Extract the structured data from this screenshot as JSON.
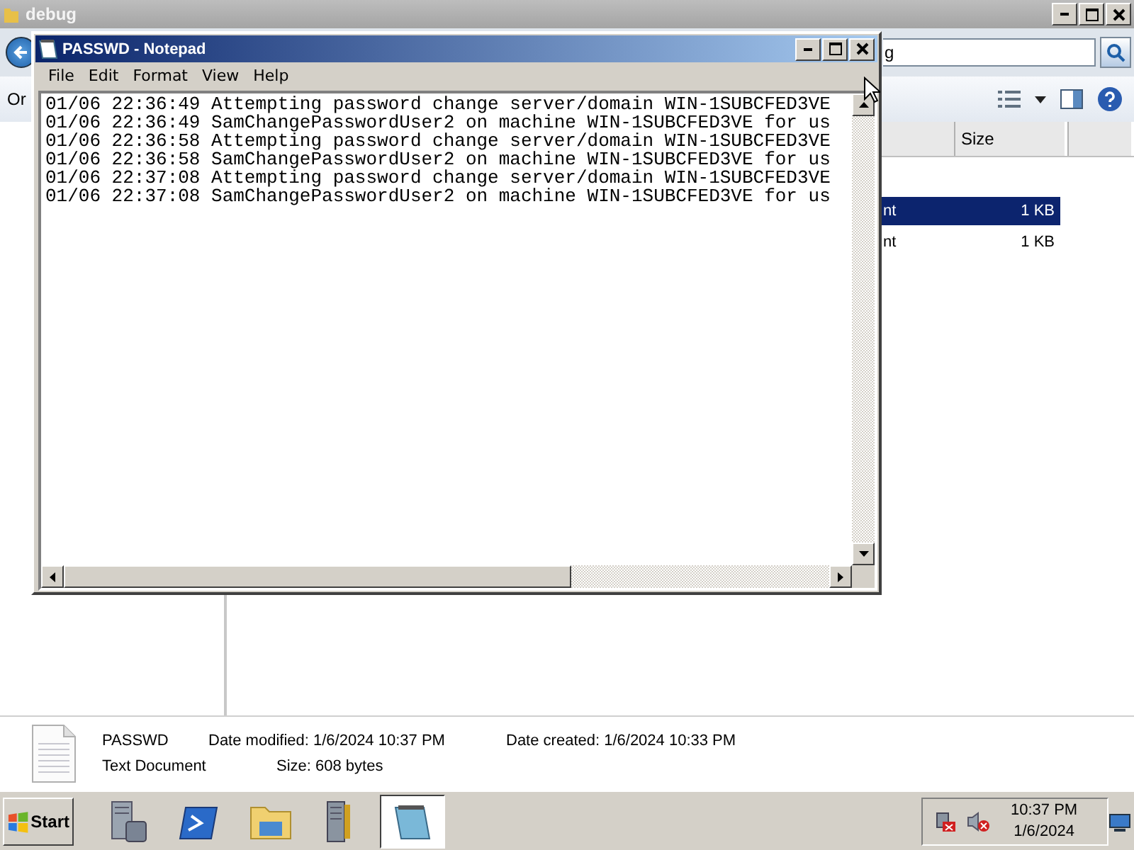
{
  "explorer": {
    "title": "debug",
    "address": "g",
    "toolbar_label": "Or",
    "columns": [
      "Size"
    ],
    "rows": [
      {
        "type": "nt",
        "size": "1 KB",
        "selected": true
      },
      {
        "type": "nt",
        "size": "1 KB",
        "selected": false
      }
    ],
    "details": {
      "name": "PASSWD",
      "type": "Text Document",
      "fields": [
        {
          "label": "Date modified:",
          "value": "1/6/2024 10:37 PM"
        },
        {
          "label": "Date created:",
          "value": "1/6/2024 10:33 PM"
        },
        {
          "label": "Size:",
          "value": "608 bytes"
        }
      ]
    }
  },
  "notepad": {
    "title": "PASSWD - Notepad",
    "menu": [
      "File",
      "Edit",
      "Format",
      "View",
      "Help"
    ],
    "lines": [
      "01/06 22:36:49 Attempting password change server/domain WIN-1SUBCFED3VE",
      "01/06 22:36:49 SamChangePasswordUser2 on machine WIN-1SUBCFED3VE for us",
      "01/06 22:36:58 Attempting password change server/domain WIN-1SUBCFED3VE",
      "01/06 22:36:58 SamChangePasswordUser2 on machine WIN-1SUBCFED3VE for us",
      "01/06 22:37:08 Attempting password change server/domain WIN-1SUBCFED3VE",
      "01/06 22:37:08 SamChangePasswordUser2 on machine WIN-1SUBCFED3VE for us"
    ]
  },
  "taskbar": {
    "start": "Start",
    "apps": [
      {
        "kind": "server",
        "selected": false
      },
      {
        "kind": "shell",
        "selected": false
      },
      {
        "kind": "folder",
        "selected": false
      },
      {
        "kind": "tools",
        "selected": false
      },
      {
        "kind": "notepad",
        "selected": true
      }
    ],
    "time": "10:37 PM",
    "date": "1/6/2024"
  }
}
